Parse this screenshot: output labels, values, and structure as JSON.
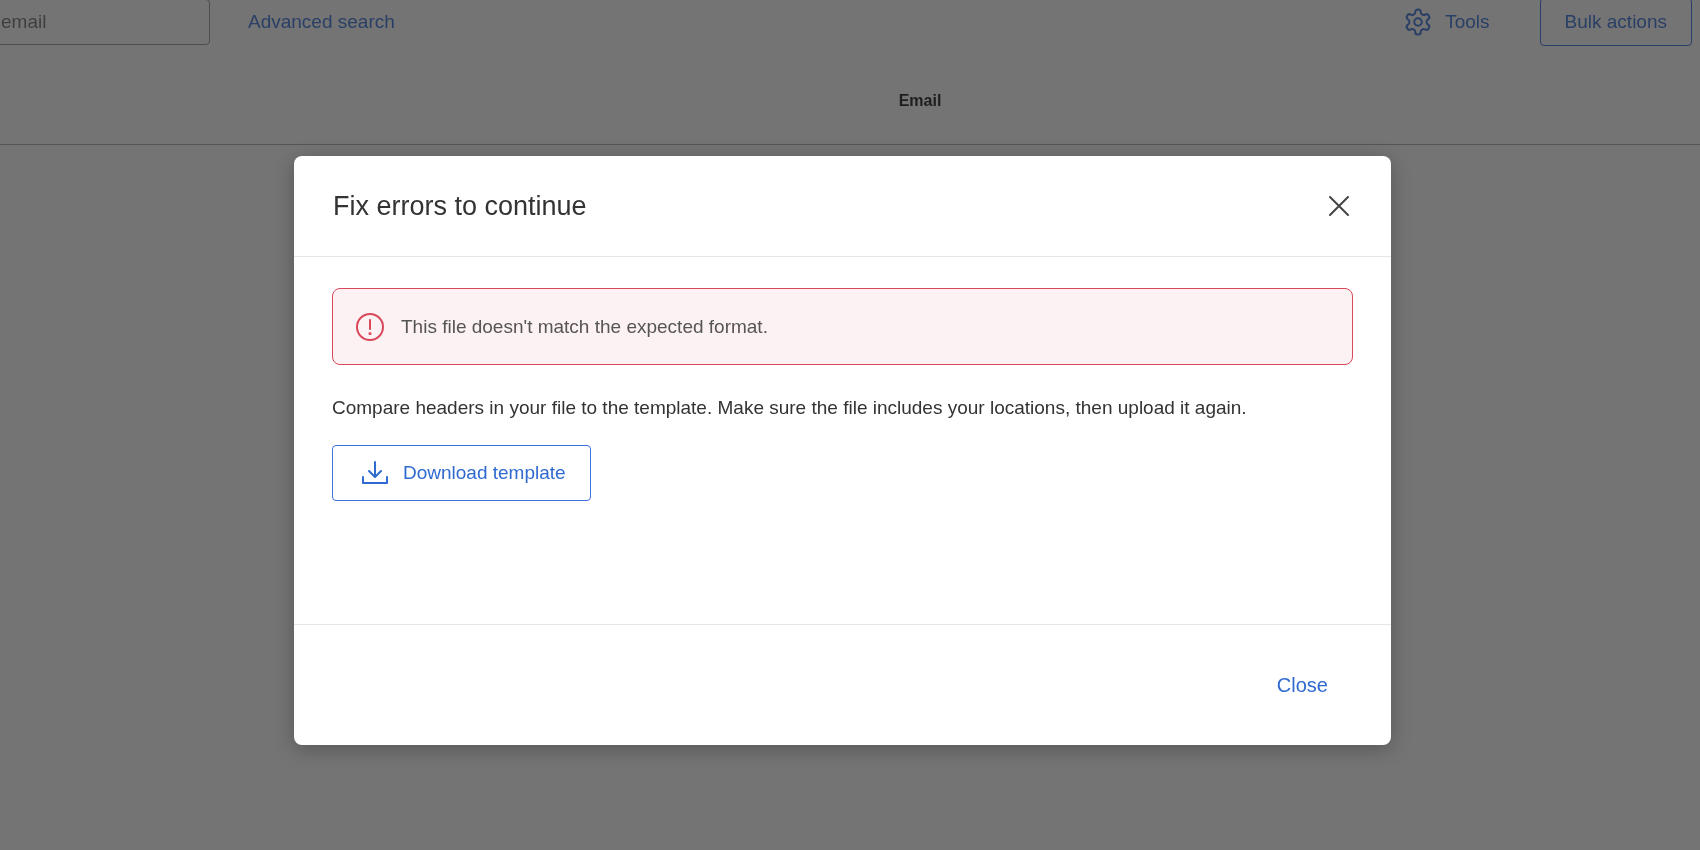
{
  "toolbar": {
    "search": {
      "placeholder": "email"
    },
    "advanced_search": "Advanced search",
    "tools": "Tools",
    "bulk_actions": "Bulk actions"
  },
  "table": {
    "columns": [
      "Email"
    ]
  },
  "dialog": {
    "title": "Fix errors to continue",
    "error": {
      "kind": "error",
      "message": "This file doesn't match the expected format."
    },
    "description": "Compare headers in your file to the template. Make sure the file includes your locations, then upload it again.",
    "download_button": "Download template",
    "footer_button": "Close"
  }
}
